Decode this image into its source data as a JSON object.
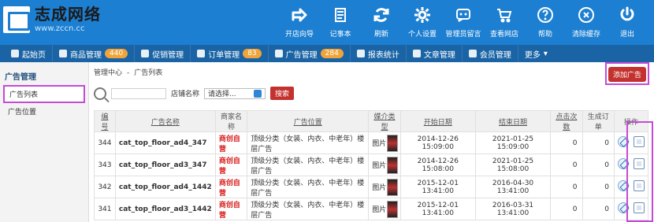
{
  "brand": {
    "title": "志成网络",
    "url": "www.zccn.cc"
  },
  "top_nav": [
    {
      "label": "开店向导",
      "icon": "arrow-icon"
    },
    {
      "label": "记事本",
      "icon": "note-icon"
    },
    {
      "label": "刷新",
      "icon": "refresh-icon"
    },
    {
      "label": "个人设置",
      "icon": "gear-icon"
    },
    {
      "label": "管理员留言",
      "icon": "chat-icon"
    },
    {
      "label": "查看网店",
      "icon": "cart-icon"
    },
    {
      "label": "帮助",
      "icon": "help-icon"
    },
    {
      "label": "清除缓存",
      "icon": "close-circle-icon"
    },
    {
      "label": "退出",
      "icon": "power-icon"
    }
  ],
  "menu": [
    {
      "label": "起始页",
      "badge": ""
    },
    {
      "label": "商品管理",
      "badge": "440"
    },
    {
      "label": "促销管理",
      "badge": ""
    },
    {
      "label": "订单管理",
      "badge": "83"
    },
    {
      "label": "广告管理",
      "badge": "284"
    },
    {
      "label": "报表统计",
      "badge": ""
    },
    {
      "label": "文章管理",
      "badge": ""
    },
    {
      "label": "会员管理",
      "badge": ""
    },
    {
      "label": "更多",
      "badge": ""
    }
  ],
  "sidebar": {
    "title": "广告管理",
    "items": [
      {
        "label": "广告列表",
        "selected": true
      },
      {
        "label": "广告位置",
        "selected": false
      }
    ]
  },
  "breadcrumb": {
    "root": "管理中心",
    "sep": "-",
    "current": "广告列表"
  },
  "actions": {
    "add_label": "添加广告"
  },
  "filters": {
    "merchant_label": "店铺名称",
    "select_value": "请选择...",
    "search_label": "搜索"
  },
  "table": {
    "headers": [
      "编号",
      "广告名称",
      "商家名称",
      "广告位置",
      "媒介类型",
      "开始日期",
      "结束日期",
      "点击次数",
      "生成订单",
      "操作"
    ],
    "rows": [
      {
        "id": "344",
        "name": "cat_top_floor_ad4_347",
        "merchant": "商创自营",
        "position": "顶级分类（女装、内衣、中老年）楼层广告",
        "media": "图片",
        "start": "2014-12-26 15:09:00",
        "end": "2021-01-25 15:09:00",
        "clicks": "0",
        "orders": "0"
      },
      {
        "id": "343",
        "name": "cat_top_floor_ad3_347",
        "merchant": "商创自营",
        "position": "顶级分类（女装、内衣、中老年）楼层广告",
        "media": "图片",
        "start": "2014-12-26 15:08:00",
        "end": "2021-01-25 15:08:00",
        "clicks": "0",
        "orders": "0"
      },
      {
        "id": "342",
        "name": "cat_top_floor_ad4_1442",
        "merchant": "商创自营",
        "position": "顶级分类（女装、内衣、中老年）楼层广告",
        "media": "图片",
        "start": "2015-12-01 13:41:00",
        "end": "2016-04-30 13:41:00",
        "clicks": "0",
        "orders": "0"
      },
      {
        "id": "341",
        "name": "cat_top_floor_ad3_1442",
        "merchant": "商创自营",
        "position": "顶级分类（女装、内衣、中老年）楼层广告",
        "media": "图片",
        "start": "2015-12-01 13:41:00",
        "end": "2016-03-31 13:41:00",
        "clicks": "0",
        "orders": "0"
      }
    ]
  },
  "colors": {
    "topbar": "#1c7fd1",
    "menubar": "#1a64a6",
    "badge": "#f0a43a",
    "accent": "#c3322e",
    "merchant": "#d92121",
    "highlight": "#c44bd6"
  }
}
